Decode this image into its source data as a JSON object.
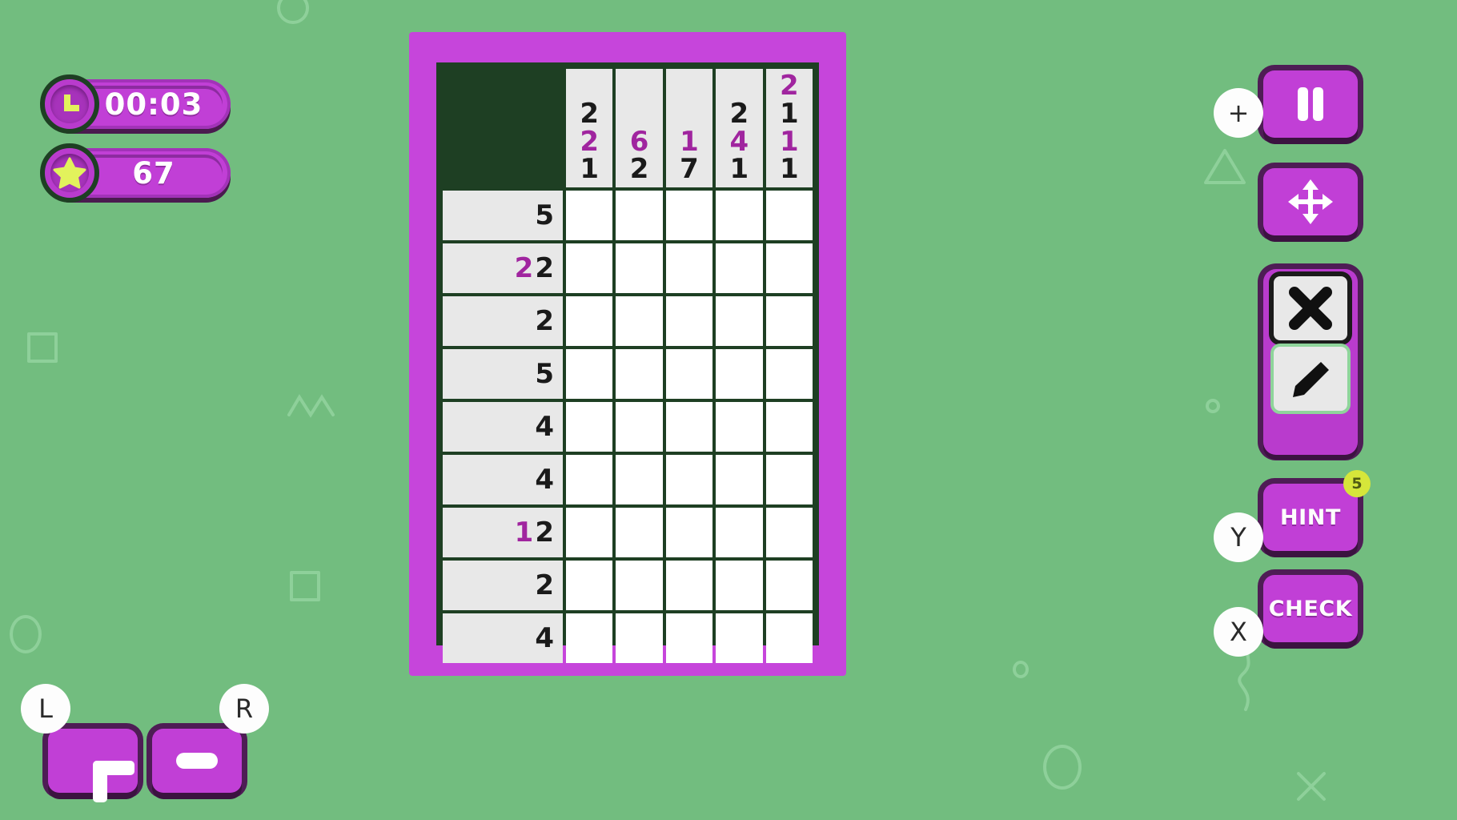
{
  "theme": {
    "background": "#72bd7f",
    "frame": "#c645db",
    "grid_border": "#1e3f23",
    "button": "#c13fd6",
    "button_shadow": "#3b1340",
    "clue_bg": "#e8e8e8",
    "cell_bg": "#ffffff",
    "accent_number": "#a0259f",
    "plain_number": "#1a1a1a",
    "badge_yellow": "#d6e63a",
    "star_yellow": "#e2f25c"
  },
  "hud": {
    "timer": {
      "icon": "clock-icon",
      "value": "00:03"
    },
    "score": {
      "icon": "star-icon",
      "value": "67"
    }
  },
  "puzzle": {
    "rows": 9,
    "cols": 5,
    "column_clues": [
      [
        {
          "v": "2",
          "accent": false
        },
        {
          "v": "2",
          "accent": true
        },
        {
          "v": "1",
          "accent": false
        }
      ],
      [
        {
          "v": "6",
          "accent": true
        },
        {
          "v": "2",
          "accent": false
        }
      ],
      [
        {
          "v": "1",
          "accent": true
        },
        {
          "v": "7",
          "accent": false
        }
      ],
      [
        {
          "v": "2",
          "accent": false
        },
        {
          "v": "4",
          "accent": true
        },
        {
          "v": "1",
          "accent": false
        }
      ],
      [
        {
          "v": "2",
          "accent": true
        },
        {
          "v": "1",
          "accent": false
        },
        {
          "v": "1",
          "accent": true
        },
        {
          "v": "1",
          "accent": false
        }
      ]
    ],
    "row_clues": [
      [
        {
          "v": "5",
          "accent": false
        }
      ],
      [
        {
          "v": "2",
          "accent": true
        },
        {
          "v": "2",
          "accent": false
        }
      ],
      [
        {
          "v": "2",
          "accent": false
        }
      ],
      [
        {
          "v": "5",
          "accent": false
        }
      ],
      [
        {
          "v": "4",
          "accent": false
        }
      ],
      [
        {
          "v": "4",
          "accent": false
        }
      ],
      [
        {
          "v": "1",
          "accent": true
        },
        {
          "v": "2",
          "accent": false
        }
      ],
      [
        {
          "v": "2",
          "accent": false
        }
      ],
      [
        {
          "v": "4",
          "accent": false
        }
      ]
    ],
    "cells": [
      [
        "empty",
        "empty",
        "empty",
        "empty",
        "empty"
      ],
      [
        "empty",
        "empty",
        "empty",
        "empty",
        "empty"
      ],
      [
        "empty",
        "empty",
        "empty",
        "empty",
        "empty"
      ],
      [
        "empty",
        "empty",
        "empty",
        "empty",
        "empty"
      ],
      [
        "empty",
        "empty",
        "empty",
        "empty",
        "empty"
      ],
      [
        "empty",
        "empty",
        "empty",
        "empty",
        "empty"
      ],
      [
        "empty",
        "empty",
        "empty",
        "empty",
        "empty"
      ],
      [
        "empty",
        "empty",
        "empty",
        "empty",
        "empty"
      ],
      [
        "empty",
        "empty",
        "empty",
        "empty",
        "empty"
      ]
    ]
  },
  "controls": {
    "pause": {
      "icon": "pause-icon",
      "key": "+"
    },
    "move": {
      "icon": "move-arrows-icon"
    },
    "tools": [
      {
        "name": "mark-x-tool",
        "icon": "x-icon",
        "selected": true
      },
      {
        "name": "fill-pencil-tool",
        "icon": "pencil-icon",
        "selected": false
      }
    ],
    "hint": {
      "label": "HINT",
      "key": "Y",
      "count": "5"
    },
    "check": {
      "label": "CHECK",
      "key": "X"
    },
    "zoom_in": {
      "icon": "plus-icon",
      "key": "L"
    },
    "zoom_out": {
      "icon": "minus-icon",
      "key": "R"
    }
  }
}
